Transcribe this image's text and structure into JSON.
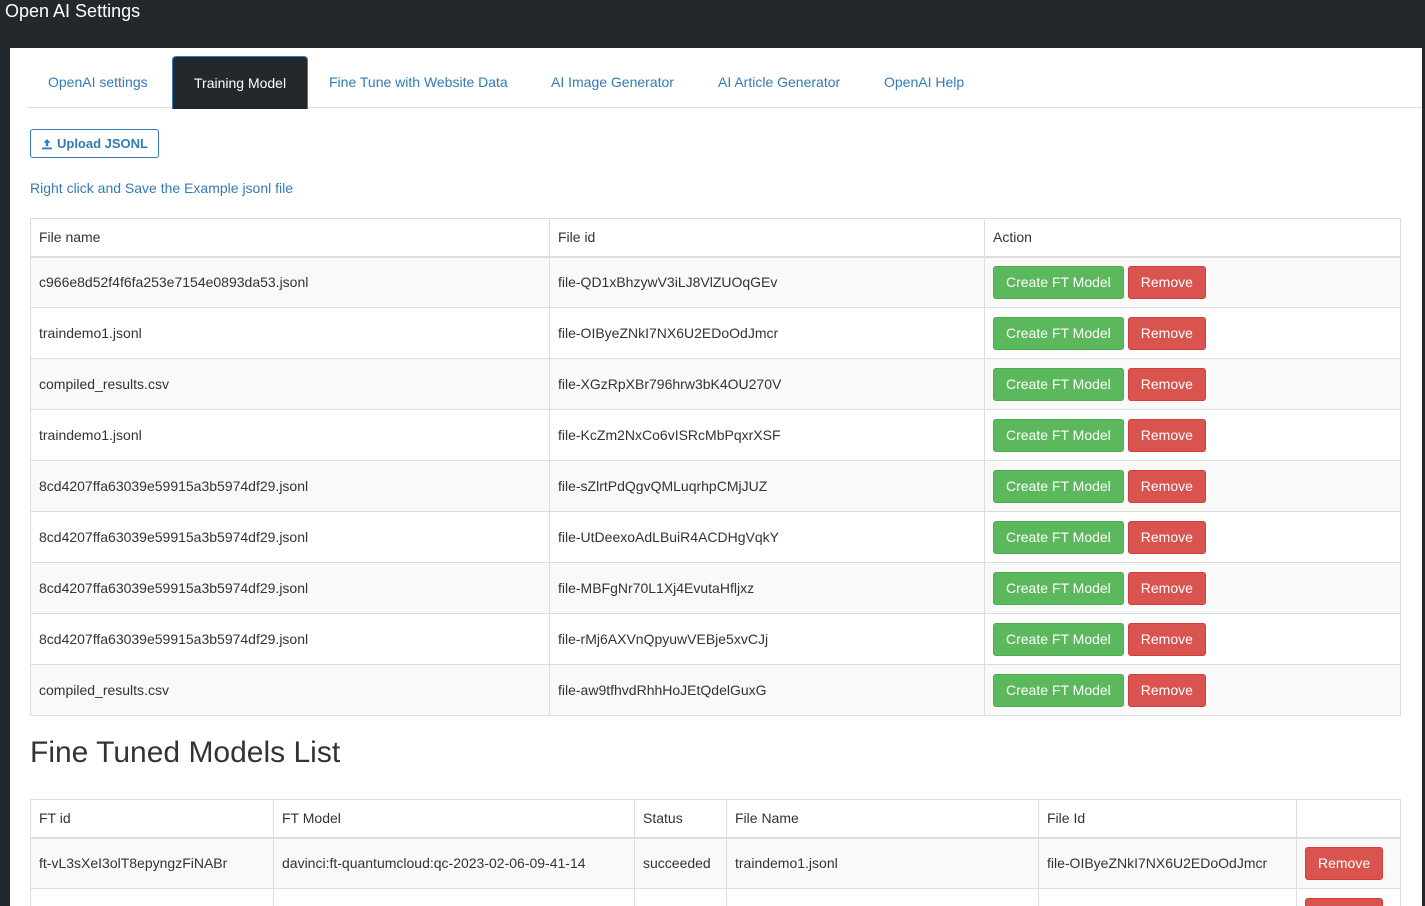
{
  "window": {
    "title": "Open AI Settings"
  },
  "tabs": [
    {
      "label": "OpenAI settings",
      "active": false
    },
    {
      "label": "Training Model",
      "active": true
    },
    {
      "label": "Fine Tune with Website Data",
      "active": false
    },
    {
      "label": "AI Image Generator",
      "active": false
    },
    {
      "label": "AI Article Generator",
      "active": false
    },
    {
      "label": "OpenAI Help",
      "active": false
    }
  ],
  "upload": {
    "label": "Upload JSONL",
    "icon": "upload-icon"
  },
  "example_link": "Right click and Save the Example jsonl file",
  "files_table": {
    "headers": {
      "file_name": "File name",
      "file_id": "File id",
      "action": "Action"
    },
    "create_label": "Create FT Model",
    "remove_label": "Remove",
    "rows": [
      {
        "name": "c966e8d52f4f6fa253e7154e0893da53.jsonl",
        "id": "file-QD1xBhzywV3iLJ8VlZUOqGEv"
      },
      {
        "name": "traindemo1.jsonl",
        "id": "file-OIByeZNkI7NX6U2EDoOdJmcr"
      },
      {
        "name": "compiled_results.csv",
        "id": "file-XGzRpXBr796hrw3bK4OU270V"
      },
      {
        "name": "traindemo1.jsonl",
        "id": "file-KcZm2NxCo6vISRcMbPqxrXSF"
      },
      {
        "name": "8cd4207ffa63039e59915a3b5974df29.jsonl",
        "id": "file-sZlrtPdQgvQMLuqrhpCMjJUZ"
      },
      {
        "name": "8cd4207ffa63039e59915a3b5974df29.jsonl",
        "id": "file-UtDeexoAdLBuiR4ACDHgVqkY"
      },
      {
        "name": "8cd4207ffa63039e59915a3b5974df29.jsonl",
        "id": "file-MBFgNr70L1Xj4EvutaHfljxz"
      },
      {
        "name": "8cd4207ffa63039e59915a3b5974df29.jsonl",
        "id": "file-rMj6AXVnQpyuwVEBje5xvCJj"
      },
      {
        "name": "compiled_results.csv",
        "id": "file-aw9tfhvdRhhHoJEtQdelGuxG"
      }
    ]
  },
  "models_section": {
    "title": "Fine Tuned Models List",
    "headers": {
      "ft_id": "FT id",
      "ft_model": "FT Model",
      "status": "Status",
      "file_name": "File Name",
      "file_id": "File Id",
      "action": ""
    },
    "remove_label": "Remove",
    "rows": [
      {
        "ft_id": "ft-vL3sXeI3olT8epyngzFiNABr",
        "ft_model": "davinci:ft-quantumcloud:qc-2023-02-06-09-41-14",
        "status": "succeeded",
        "file_name": "traindemo1.jsonl",
        "file_id": "file-OIByeZNkI7NX6U2EDoOdJmcr"
      },
      {
        "ft_id": "",
        "ft_model": "",
        "status": "",
        "file_name": "",
        "file_id": ""
      }
    ]
  },
  "colors": {
    "accent": "#337ab7",
    "success": "#5cb85c",
    "danger": "#d9534f",
    "dark": "#23282d"
  }
}
